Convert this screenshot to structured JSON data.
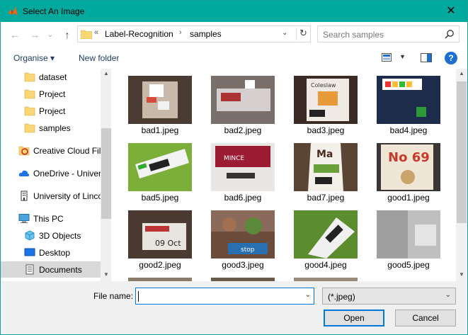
{
  "window": {
    "title": "Select An Image",
    "close_glyph": "✕"
  },
  "nav": {
    "back_glyph": "←",
    "forward_glyph": "→",
    "recent_glyph": "⌄",
    "up_glyph": "↑",
    "breadcrumb": [
      "Label-Recognition",
      "samples"
    ],
    "overflow_glyph": "«",
    "separator_glyph": "›",
    "refresh_glyph": "↻",
    "dropdown_glyph": "⌄",
    "search_placeholder": "Search samples"
  },
  "toolbar": {
    "organise_label": "Organise ▾",
    "new_folder_label": "New folder",
    "view_dropdown_glyph": "▼",
    "help_glyph": "?"
  },
  "sidebar": {
    "items": [
      {
        "label": "dataset",
        "icon": "folder-icon"
      },
      {
        "label": "Project",
        "icon": "folder-icon"
      },
      {
        "label": "Project",
        "icon": "folder-icon"
      },
      {
        "label": "samples",
        "icon": "folder-icon"
      },
      {
        "label": "Creative Cloud Fil",
        "icon": "creative-cloud-icon"
      },
      {
        "label": "OneDrive - Univer",
        "icon": "cloud-icon"
      },
      {
        "label": "University of Linco",
        "icon": "building-icon"
      },
      {
        "label": "This PC",
        "icon": "computer-icon"
      },
      {
        "label": "3D Objects",
        "icon": "cube-icon"
      },
      {
        "label": "Desktop",
        "icon": "desktop-icon"
      },
      {
        "label": "Documents",
        "icon": "document-icon",
        "selected": true
      }
    ],
    "scroll_up_glyph": "▲",
    "scroll_down_glyph": "▼"
  },
  "files": [
    {
      "name": "bad1.jpeg"
    },
    {
      "name": "bad2.jpeg"
    },
    {
      "name": "bad3.jpeg"
    },
    {
      "name": "bad4.jpeg"
    },
    {
      "name": "bad5.jpeg"
    },
    {
      "name": "bad6.jpeg"
    },
    {
      "name": "bad7.jpeg"
    },
    {
      "name": "good1.jpeg"
    },
    {
      "name": "good2.jpeg"
    },
    {
      "name": "good3.jpeg"
    },
    {
      "name": "good4.jpeg"
    },
    {
      "name": "good5.jpeg"
    }
  ],
  "thumbnail_text": {
    "bad3": "Coleslaw",
    "bad6": "MINCE",
    "bad7": "Ma",
    "good1": "No 69",
    "good2": "09 Oct",
    "good3": "stop"
  },
  "bottom": {
    "filename_label": "File name:",
    "filename_value": "",
    "filetype_value": "(*.jpeg)",
    "dropdown_glyph": "⌄",
    "open_label": "Open",
    "cancel_label": "Cancel"
  },
  "colors": {
    "titlebar": "#00a99d",
    "accent": "#0078d7",
    "folder": "#f8d775"
  }
}
